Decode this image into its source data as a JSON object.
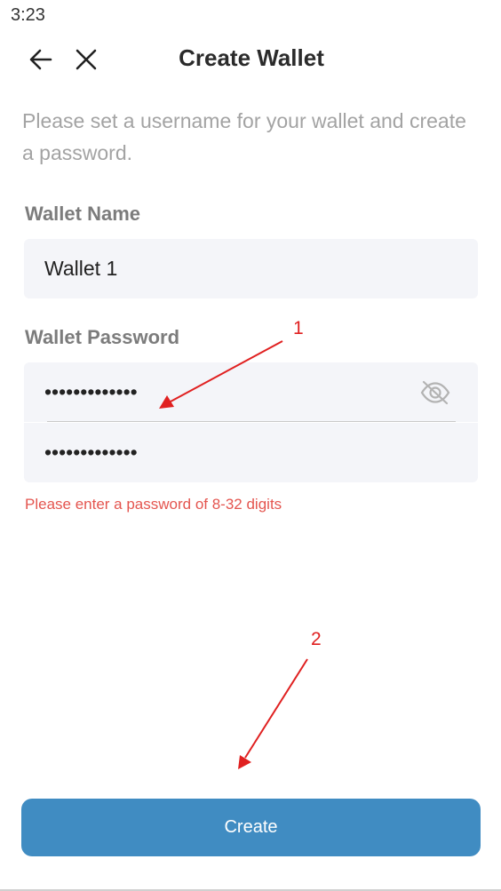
{
  "status_bar": {
    "time": "3:23"
  },
  "header": {
    "title": "Create Wallet",
    "back_icon": "arrow-left-icon",
    "close_icon": "close-icon"
  },
  "intro_text": "Please set a username for your wallet and create a password.",
  "wallet_name": {
    "label": "Wallet Name",
    "value": "Wallet 1"
  },
  "wallet_password": {
    "label": "Wallet Password",
    "value": "•••••••••••••",
    "confirm_value": "•••••••••••••",
    "toggle_icon": "eye-off-icon"
  },
  "error_message": "Please enter a password of 8-32 digits",
  "create_button": {
    "label": "Create"
  },
  "annotations": {
    "first": "1",
    "second": "2"
  },
  "colors": {
    "primary_button": "#408cc2",
    "error": "#e4554f",
    "field_bg": "#f4f5f9",
    "annotation": "#e02020"
  }
}
